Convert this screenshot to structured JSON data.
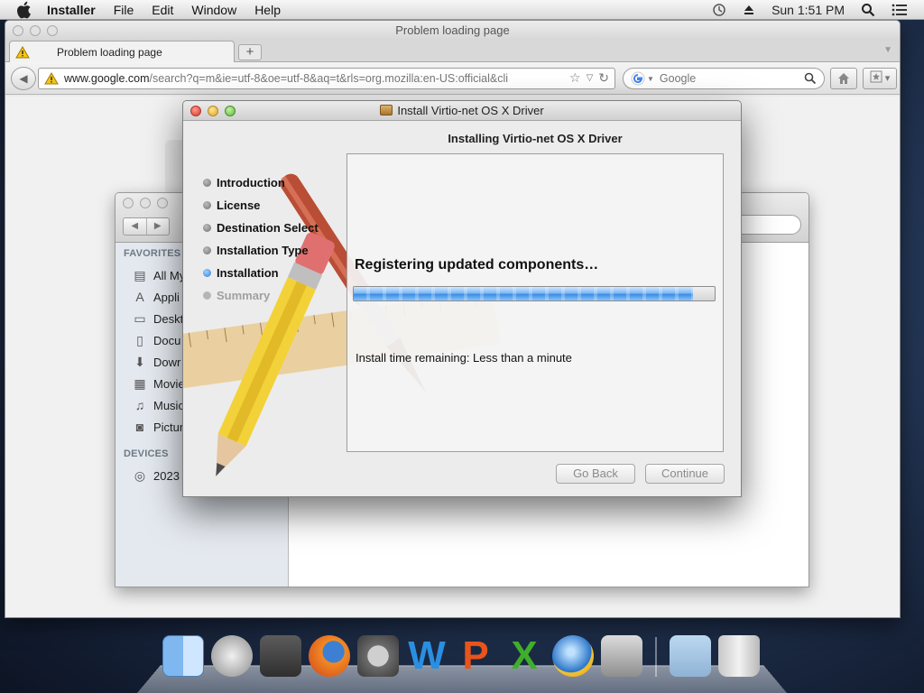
{
  "menubar": {
    "app_name": "Installer",
    "items": [
      "File",
      "Edit",
      "Window",
      "Help"
    ],
    "clock": "Sun 1:51 PM",
    "icons": [
      "time-machine-icon",
      "eject-icon",
      "spotlight-icon",
      "notification-list-icon"
    ]
  },
  "browser": {
    "window_title": "Problem loading page",
    "tab_title": "Problem loading page",
    "new_tab_label": "+",
    "url_host": "www.google.com",
    "url_path": "/search?q=m&ie=utf-8&oe=utf-8&aq=t&rls=org.mozilla:en-US:official&cli",
    "search_placeholder": "Google"
  },
  "finder": {
    "sidebar": {
      "favorites_label": "FAVORITES",
      "favorites": [
        {
          "label": "All My",
          "icon": "all-files-icon"
        },
        {
          "label": "Appli",
          "icon": "applications-icon"
        },
        {
          "label": "Deskt",
          "icon": "desktop-icon"
        },
        {
          "label": "Docu",
          "icon": "documents-icon"
        },
        {
          "label": "Dowr",
          "icon": "downloads-icon"
        },
        {
          "label": "Movie",
          "icon": "movies-icon"
        },
        {
          "label": "Music",
          "icon": "music-icon"
        },
        {
          "label": "Pictur",
          "icon": "pictures-icon"
        }
      ],
      "devices_label": "DEVICES",
      "devices": [
        {
          "label": "2023",
          "icon": "disk-icon"
        }
      ]
    }
  },
  "installer": {
    "window_title": "Install Virtio-net OS X Driver",
    "heading": "Installing Virtio-net OS X Driver",
    "steps": [
      {
        "label": "Introduction",
        "state": "done"
      },
      {
        "label": "License",
        "state": "done"
      },
      {
        "label": "Destination Select",
        "state": "done"
      },
      {
        "label": "Installation Type",
        "state": "done"
      },
      {
        "label": "Installation",
        "state": "current"
      },
      {
        "label": "Summary",
        "state": "pending"
      }
    ],
    "status_text": "Registering updated components…",
    "progress_percent": 94,
    "remaining_text": "Install time remaining: Less than a minute",
    "back_label": "Go Back",
    "continue_label": "Continue"
  },
  "dock": {
    "apps": [
      "finder-icon",
      "launchpad-icon",
      "image-capture-icon",
      "firefox-icon",
      "system-preferences-icon",
      "word-icon",
      "powerpoint-icon",
      "excel-icon",
      "network-utility-icon",
      "installer-icon"
    ],
    "stack_items": [
      "downloads-stack-icon",
      "trash-icon"
    ]
  },
  "colors": {
    "accent_blue": "#3b8ee6",
    "close_red": "#d9372a",
    "minimize_yellow": "#e0a523",
    "zoom_green": "#5fb83d"
  }
}
